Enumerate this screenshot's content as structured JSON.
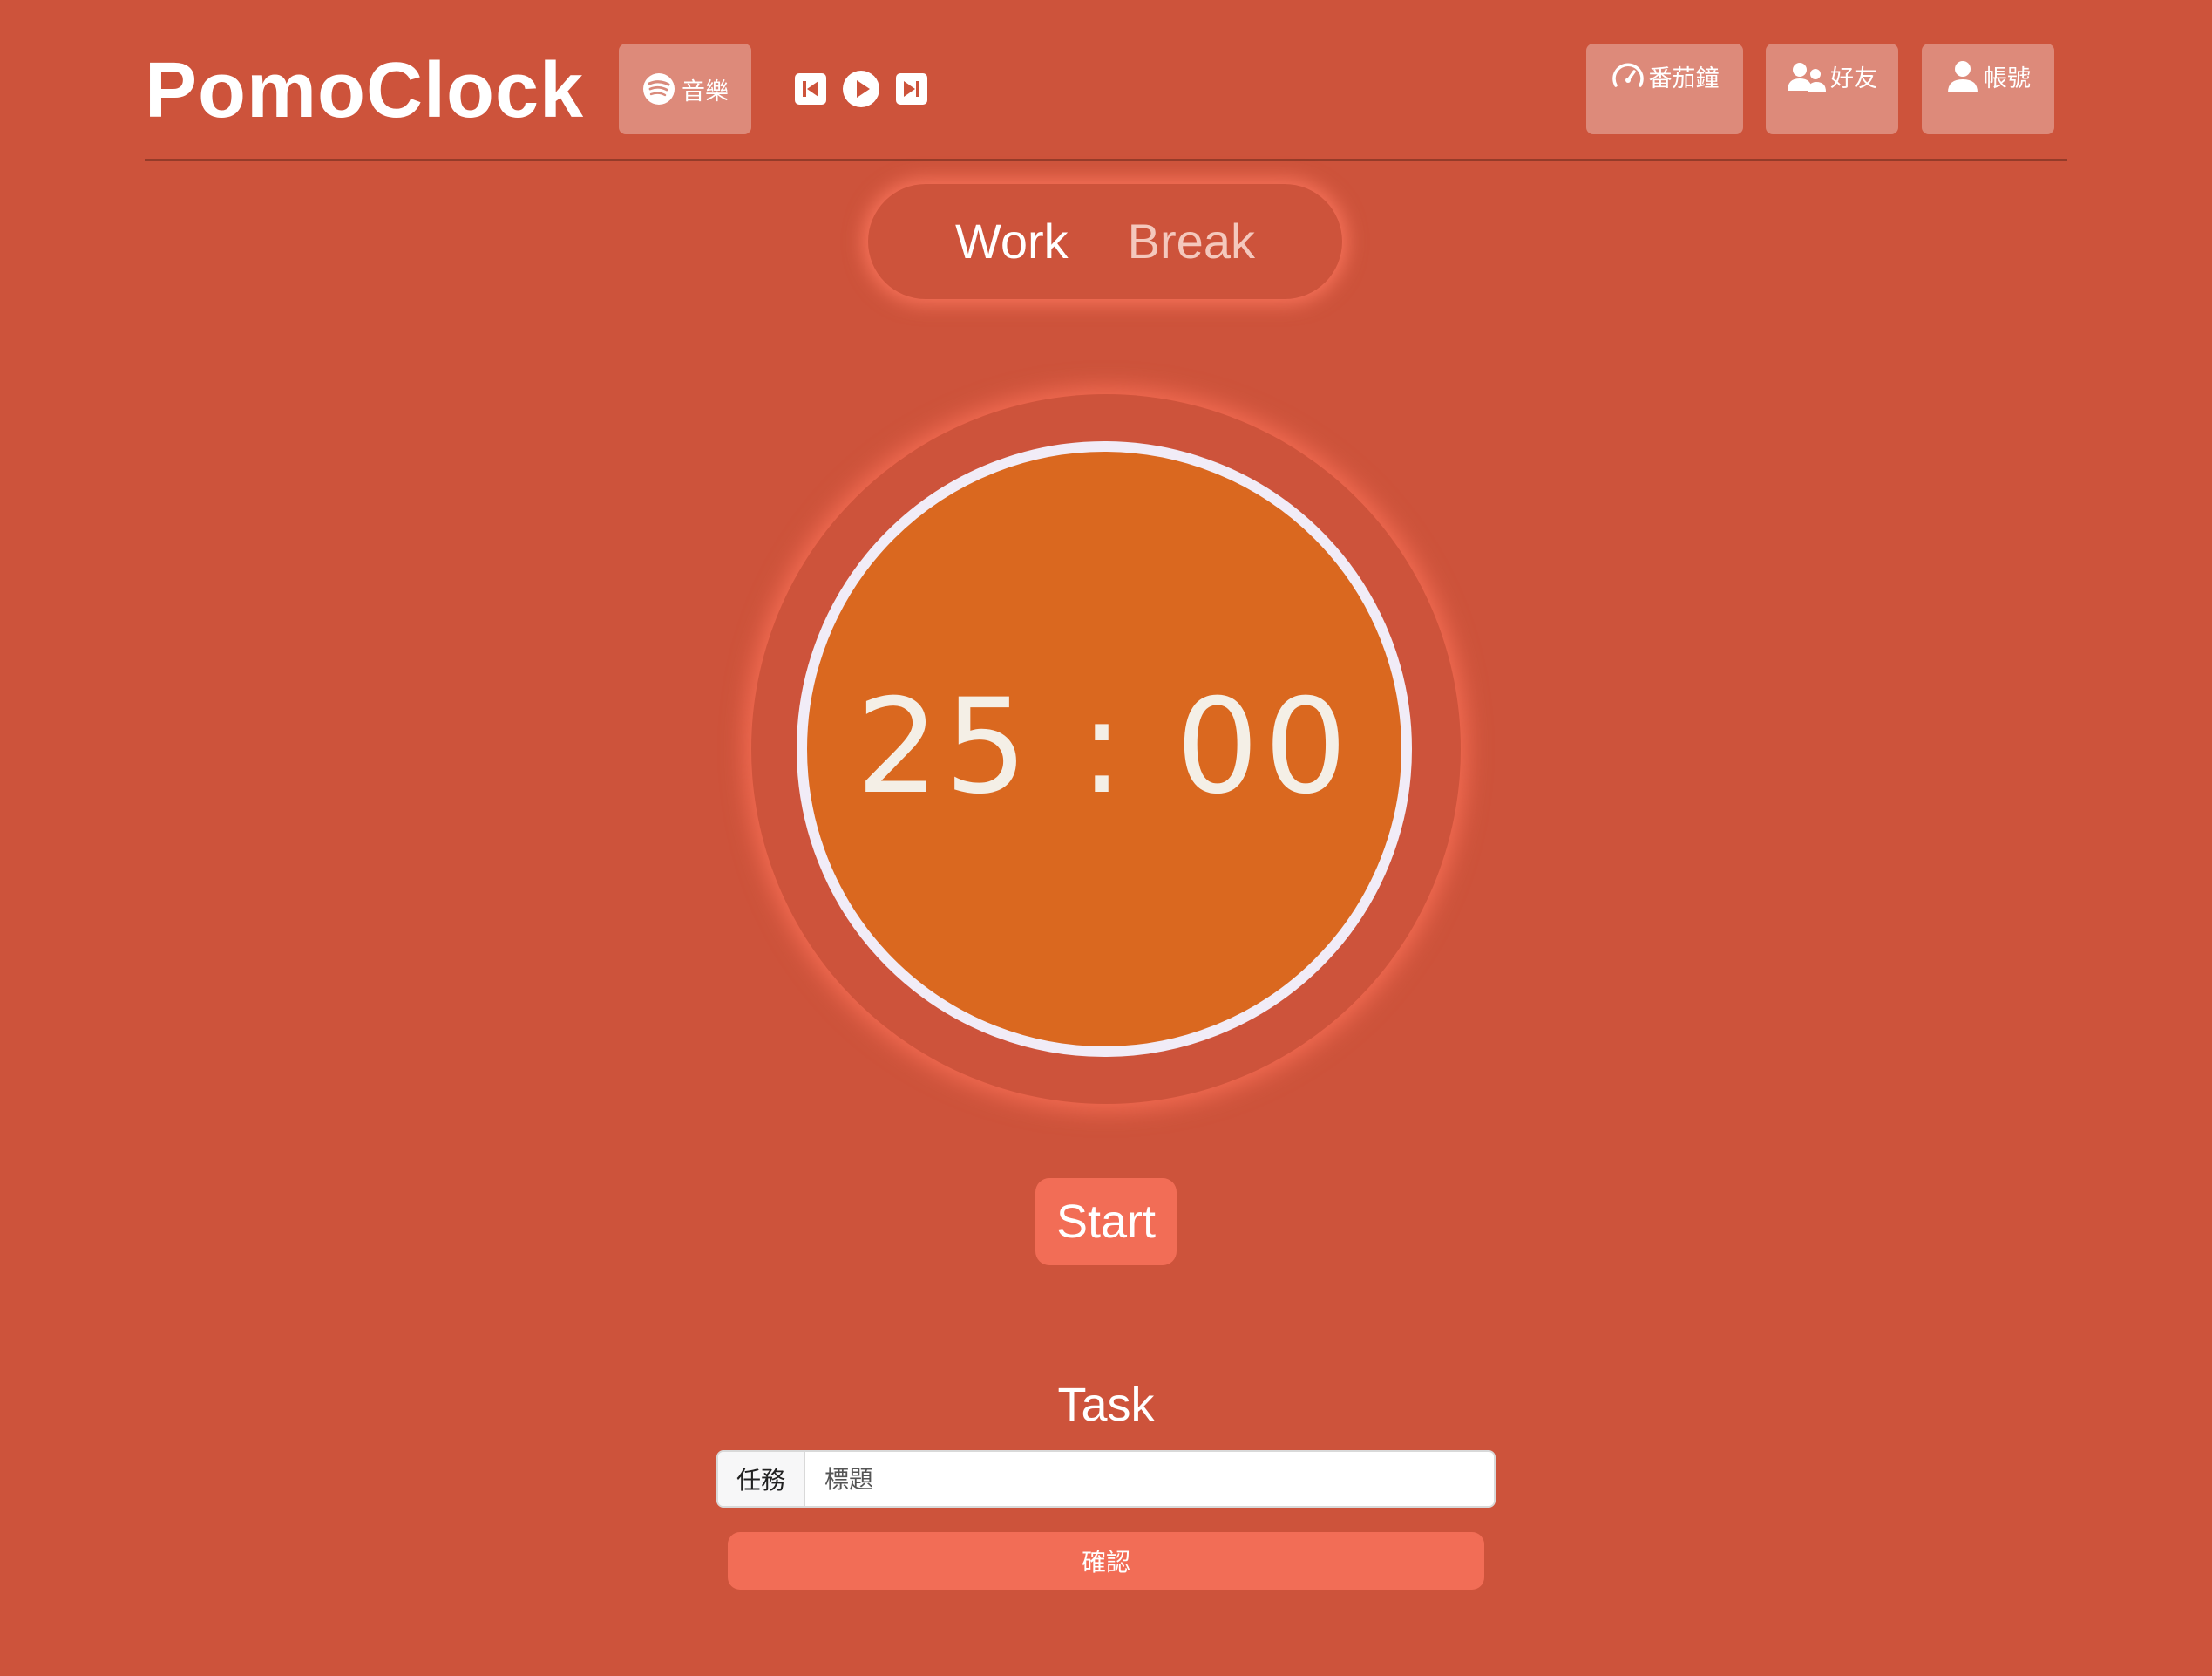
{
  "app": {
    "brand": "PomoClock"
  },
  "header": {
    "music_label": "音樂",
    "music_icon": "spotify-icon",
    "player": {
      "prev_icon": "skip-back-icon",
      "play_icon": "play-circle-icon",
      "next_icon": "skip-forward-icon"
    },
    "nav": [
      {
        "label": "番茄鐘",
        "icon": "speedometer-icon"
      },
      {
        "label": "好友",
        "icon": "people-icon"
      },
      {
        "label": "帳號",
        "icon": "person-icon"
      }
    ]
  },
  "modes": {
    "work": "Work",
    "break": "Break",
    "active": "Work"
  },
  "timer": {
    "display": "25 : 00"
  },
  "controls": {
    "start_label": "Start"
  },
  "task": {
    "heading": "Task",
    "prefix": "任務",
    "input_placeholder": "標題",
    "confirm_label": "確認"
  },
  "colors": {
    "background": "#cd533b",
    "timer_fill": "#da681f",
    "timer_ring": "#f1ecf7",
    "accent_button": "#f26d56",
    "glow": "#ff785f"
  }
}
